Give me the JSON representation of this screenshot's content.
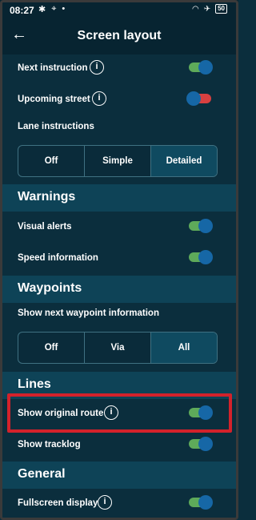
{
  "status_bar": {
    "time": "08:27",
    "battery": "50"
  },
  "app_bar": {
    "title": "Screen layout"
  },
  "rows": {
    "next_instruction": {
      "label": "Next instruction",
      "on": true
    },
    "upcoming_street": {
      "label": "Upcoming street",
      "on": false
    },
    "lane_instructions": {
      "label": "Lane instructions"
    },
    "visual_alerts": {
      "label": "Visual alerts",
      "on": true
    },
    "speed_information": {
      "label": "Speed information",
      "on": true
    },
    "show_next_waypoint": {
      "label": "Show next waypoint information"
    },
    "show_original_route": {
      "label": "Show original route",
      "on": true
    },
    "show_tracklog": {
      "label": "Show tracklog",
      "on": true
    },
    "fullscreen_display": {
      "label": "Fullscreen display",
      "on": true
    }
  },
  "lane_options": {
    "items": [
      "Off",
      "Simple",
      "Detailed"
    ],
    "selected": "Detailed"
  },
  "waypoint_options": {
    "items": [
      "Off",
      "Via",
      "All"
    ],
    "selected": "All"
  },
  "sections": {
    "warnings": "Warnings",
    "waypoints": "Waypoints",
    "lines": "Lines",
    "general": "General"
  },
  "info_glyph": "i",
  "colors": {
    "background": "#0b2e3d",
    "section": "#0e4357",
    "toggle_on": "#5eaa5a",
    "toggle_off": "#d84040",
    "knob": "#1667a6",
    "highlight": "#d3222b"
  }
}
